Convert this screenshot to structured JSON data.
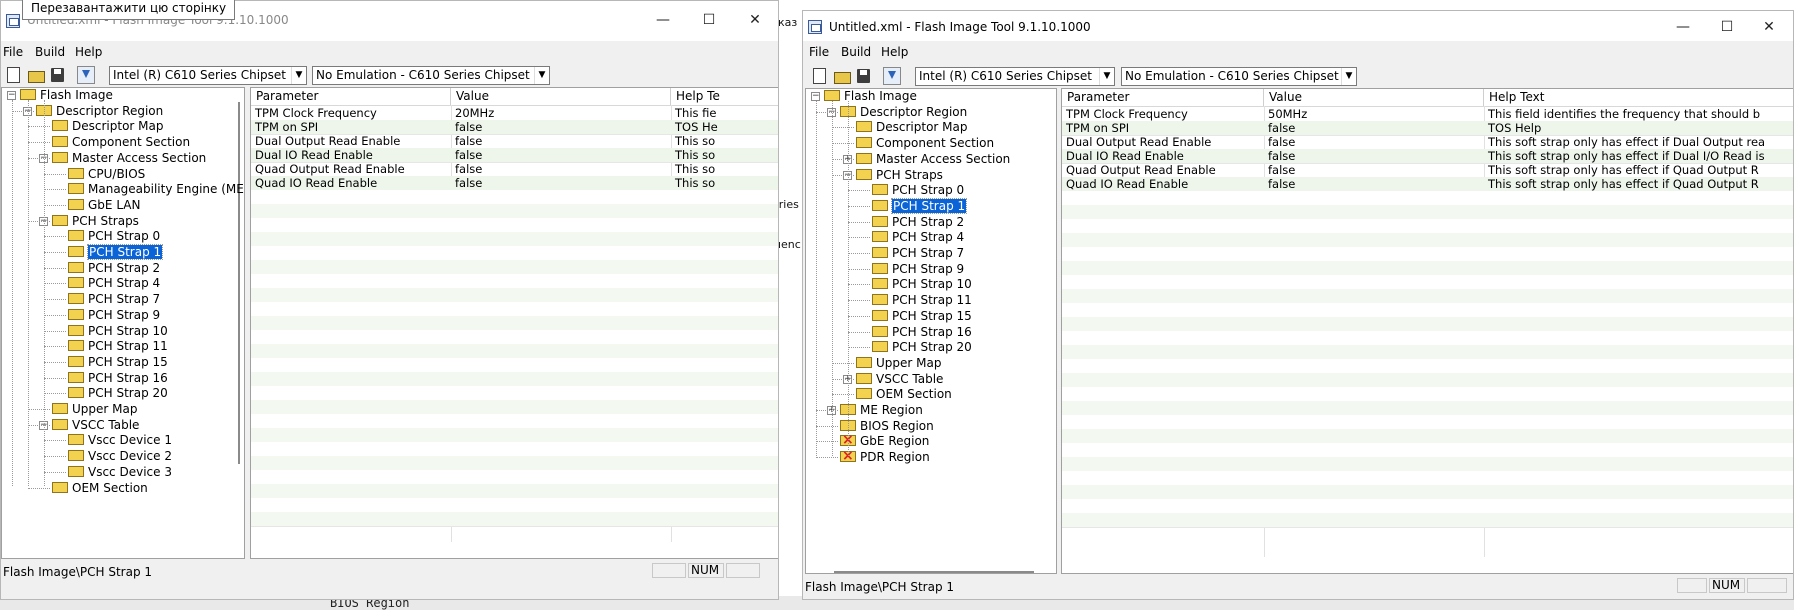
{
  "tooltip": "Перезавантажити цю сторінку",
  "background": {
    "code_text": "BIOS Region",
    "partial_tab": "eries",
    "partial_word": "uenc",
    "partial_text": "каз"
  },
  "left": {
    "title": "Untitled.xml - Flash Image Tool 9.1.10.1000",
    "menu": [
      "File",
      "Build",
      "Help"
    ],
    "chipset": "Intel (R) C610 Series Chipset",
    "emulation": "No Emulation - C610 Series Chipset",
    "tree": [
      "Flash Image",
      "Descriptor Region",
      "Descriptor Map",
      "Component Section",
      "Master Access Section",
      "CPU/BIOS",
      "Manageability Engine (ME",
      "GbE LAN",
      "PCH Straps",
      "PCH Strap 0",
      "PCH Strap 1",
      "PCH Strap 2",
      "PCH Strap 4",
      "PCH Strap 7",
      "PCH Strap 9",
      "PCH Strap 10",
      "PCH Strap 11",
      "PCH Strap 15",
      "PCH Strap 16",
      "PCH Strap 20",
      "Upper Map",
      "VSCC Table",
      "Vscc Device 1",
      "Vscc Device 2",
      "Vscc Device 3",
      "OEM Section"
    ],
    "columns": [
      "Parameter",
      "Value",
      "Help Te"
    ],
    "rows": [
      {
        "param": "TPM Clock Frequency",
        "value": "20MHz",
        "help": "This fie"
      },
      {
        "param": "TPM on SPI",
        "value": "false",
        "help": "TOS He"
      },
      {
        "param": "Dual Output Read Enable",
        "value": "false",
        "help": "This so"
      },
      {
        "param": "Dual IO Read Enable",
        "value": "false",
        "help": "This so"
      },
      {
        "param": "Quad Output Read Enable",
        "value": "false",
        "help": "This so"
      },
      {
        "param": "Quad IO Read Enable",
        "value": "false",
        "help": "This so"
      }
    ],
    "status_path": "Flash Image\\PCH Strap 1",
    "num": "NUM"
  },
  "right": {
    "title": "Untitled.xml - Flash Image Tool 9.1.10.1000",
    "menu": [
      "File",
      "Build",
      "Help"
    ],
    "chipset": "Intel (R) C610 Series Chipset",
    "emulation": "No Emulation - C610 Series Chipset",
    "tree": [
      "Flash Image",
      "Descriptor Region",
      "Descriptor Map",
      "Component Section",
      "Master Access Section",
      "PCH Straps",
      "PCH Strap 0",
      "PCH Strap 1",
      "PCH Strap 2",
      "PCH Strap 4",
      "PCH Strap 7",
      "PCH Strap 9",
      "PCH Strap 10",
      "PCH Strap 11",
      "PCH Strap 15",
      "PCH Strap 16",
      "PCH Strap 20",
      "Upper Map",
      "VSCC Table",
      "OEM Section",
      "ME Region",
      "BIOS Region",
      "GbE Region",
      "PDR Region"
    ],
    "columns": [
      "Parameter",
      "Value",
      "Help Text"
    ],
    "rows": [
      {
        "param": "TPM Clock Frequency",
        "value": "50MHz",
        "help": "This field identifies the frequency that should b"
      },
      {
        "param": "TPM on SPI",
        "value": "false",
        "help": "TOS Help"
      },
      {
        "param": "Dual Output Read Enable",
        "value": "false",
        "help": "This soft strap only has effect if Dual Output rea"
      },
      {
        "param": "Dual IO Read Enable",
        "value": "false",
        "help": "This soft strap only has effect if Dual I/O Read is"
      },
      {
        "param": "Quad Output Read Enable",
        "value": "false",
        "help": "This soft strap only has effect if Quad Output R"
      },
      {
        "param": "Quad IO Read Enable",
        "value": "false",
        "help": "This soft strap only has effect if Quad Output R"
      }
    ],
    "status_path": "Flash Image\\PCH Strap 1",
    "num": "NUM"
  }
}
